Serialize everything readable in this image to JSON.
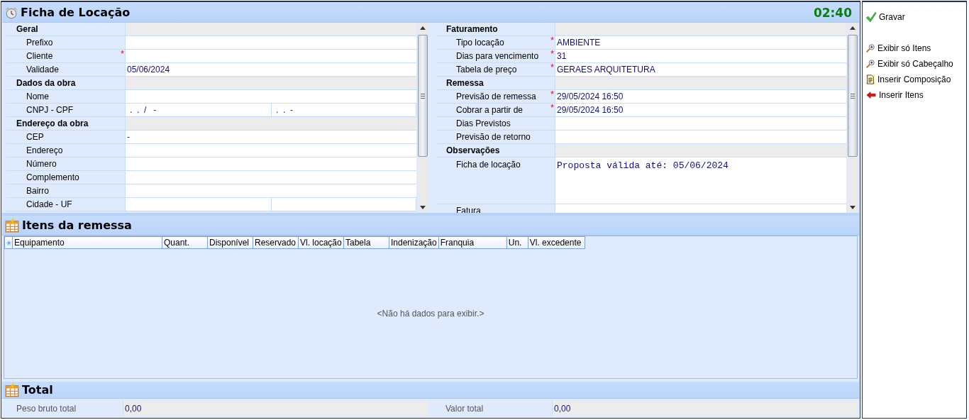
{
  "header": {
    "title": "Ficha de Locação",
    "time": "02:40"
  },
  "left_grid": {
    "sections": [
      {
        "title": "Geral",
        "rows": [
          {
            "label": "Prefixo",
            "kind": "text"
          },
          {
            "label": "Cliente",
            "kind": "text",
            "required_mark": "*"
          },
          {
            "label": "Validade",
            "kind": "text",
            "value": "05/06/2024"
          }
        ]
      },
      {
        "title": "Dados da obra",
        "rows": [
          {
            "label": "Nome",
            "kind": "text"
          },
          {
            "label": "CNPJ - CPF",
            "kind": "split",
            "values": [
              ".  .  /   -",
              ".  .  -"
            ]
          }
        ]
      },
      {
        "title": "Endereço da obra",
        "rows": [
          {
            "label": "CEP",
            "kind": "text",
            "value": "-"
          },
          {
            "label": "Endereço",
            "kind": "text"
          },
          {
            "label": "Número",
            "kind": "text"
          },
          {
            "label": "Complemento",
            "kind": "text"
          },
          {
            "label": "Bairro",
            "kind": "text"
          },
          {
            "label": "Cidade - UF",
            "kind": "split",
            "values": []
          }
        ]
      }
    ]
  },
  "right_grid": {
    "sections": [
      {
        "title": "Faturamento",
        "rows": [
          {
            "label": "Tipo locação",
            "kind": "text",
            "required_mark": "*",
            "value": "AMBIENTE"
          },
          {
            "label": "Dias para vencimento",
            "kind": "text",
            "required_mark": "*",
            "value": "31"
          },
          {
            "label": "Tabela de preço",
            "kind": "text",
            "required_mark": "*",
            "value": "GERAES ARQUITETURA"
          }
        ]
      },
      {
        "title": "Remessa",
        "rows": [
          {
            "label": "Previsão de remessa",
            "kind": "text",
            "required_mark": "*",
            "value": "29/05/2024 16:50"
          },
          {
            "label": "Cobrar a partir de",
            "kind": "text",
            "required_mark": "*",
            "value": "29/05/2024 16:50"
          },
          {
            "label": "Dias Previstos",
            "kind": "text"
          },
          {
            "label": "Previsão de retorno",
            "kind": "text"
          }
        ]
      },
      {
        "title": "Observações",
        "rows": [
          {
            "label": "Ficha de locação",
            "kind": "memo",
            "value": "Proposta válida até: 05/06/2024"
          },
          {
            "label": "Fatura",
            "kind": "text"
          }
        ]
      }
    ]
  },
  "items": {
    "title": "Itens da remessa",
    "columns": [
      "Equipamento",
      "Quant.",
      "Disponível",
      "Reservado",
      "Vl. locação",
      "Tabela",
      "Indenização",
      "Franquia",
      "Un.",
      "Vl. excedente"
    ],
    "empty_message": "<Não há dados para exibir.>"
  },
  "totals": {
    "title": "Total",
    "fields": [
      {
        "label": "Peso bruto total",
        "value": "0,00"
      },
      {
        "label": "Valor total",
        "value": "0,00"
      }
    ]
  },
  "actions": [
    {
      "label": "Gravar",
      "kind": "check"
    },
    {
      "label": "Exibir só  Itens",
      "kind": "magnifier"
    },
    {
      "label": "Exibir só Cabeçalho",
      "kind": "magnifier"
    },
    {
      "label": "Inserir Composição",
      "kind": "document"
    },
    {
      "label": "Inserir Itens",
      "kind": "arrow"
    }
  ]
}
